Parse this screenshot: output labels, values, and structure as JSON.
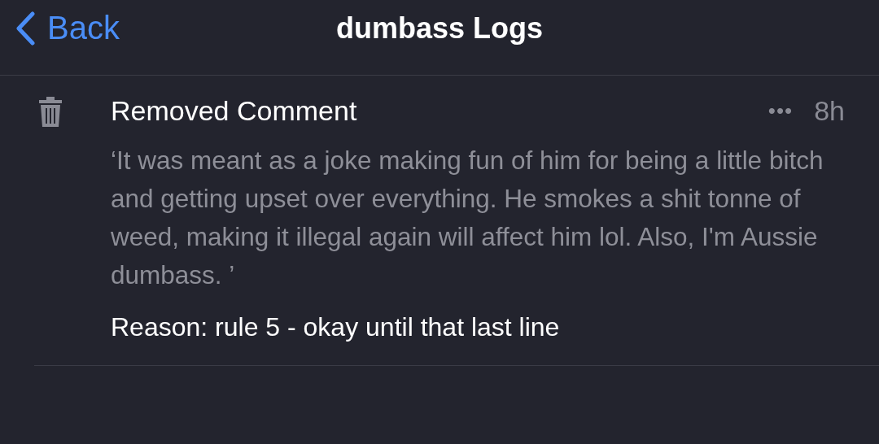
{
  "header": {
    "back_label": "Back",
    "title": "dumbass Logs"
  },
  "log_entries": [
    {
      "action": "Removed Comment",
      "more": "•••",
      "time": "8h",
      "content": "‘It was meant as a joke making fun of him for being a little bitch and getting upset over everything. He smokes a shit tonne of weed, making it illegal again will affect him lol. Also, I'm Aussie dumbass. ’",
      "reason": "Reason: rule 5 - okay until that last line"
    }
  ]
}
